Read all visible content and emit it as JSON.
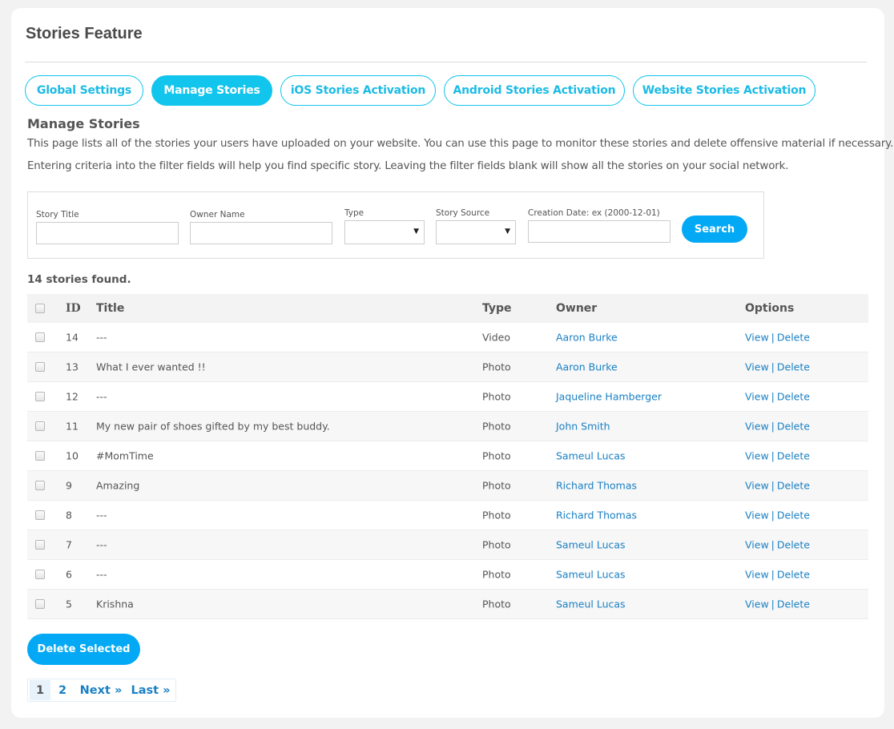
{
  "header": {
    "title": "Stories Feature"
  },
  "tabs": [
    {
      "label": "Global Settings",
      "active": false
    },
    {
      "label": "Manage Stories",
      "active": true
    },
    {
      "label": "iOS Stories Activation",
      "active": false
    },
    {
      "label": "Android Stories Activation",
      "active": false
    },
    {
      "label": "Website Stories Activation",
      "active": false
    }
  ],
  "section": {
    "title": "Manage Stories",
    "description_1": "This page lists all of the stories your users have uploaded on your website. You can use this page to monitor these stories and delete offensive material if necessary.",
    "description_2": "Entering criteria into the filter fields will help you find specific story. Leaving the filter fields blank will show all the stories on your social network."
  },
  "filters": {
    "story_title": {
      "label": "Story Title",
      "value": ""
    },
    "owner_name": {
      "label": "Owner Name",
      "value": ""
    },
    "type": {
      "label": "Type",
      "selected": ""
    },
    "story_source": {
      "label": "Story Source",
      "selected": ""
    },
    "creation_date": {
      "label": "Creation Date: ex (2000-12-01)",
      "value": ""
    },
    "search_label": "Search"
  },
  "results": {
    "count_text": "14 stories found."
  },
  "table": {
    "columns": {
      "id": "ID",
      "title": "Title",
      "type": "Type",
      "owner": "Owner",
      "options": "Options"
    },
    "view_label": "View",
    "delete_label": "Delete",
    "separator": "|",
    "rows": [
      {
        "id": "14",
        "title": "---",
        "type": "Video",
        "owner": "Aaron Burke"
      },
      {
        "id": "13",
        "title": "What I ever wanted !!",
        "type": "Photo",
        "owner": "Aaron Burke"
      },
      {
        "id": "12",
        "title": "---",
        "type": "Photo",
        "owner": "Jaqueline Hamberger"
      },
      {
        "id": "11",
        "title": "My new pair of shoes gifted by my best buddy.",
        "type": "Photo",
        "owner": "John Smith"
      },
      {
        "id": "10",
        "title": "#MomTime",
        "type": "Photo",
        "owner": "Sameul Lucas"
      },
      {
        "id": "9",
        "title": "Amazing",
        "type": "Photo",
        "owner": "Richard Thomas"
      },
      {
        "id": "8",
        "title": "---",
        "type": "Photo",
        "owner": "Richard Thomas"
      },
      {
        "id": "7",
        "title": "---",
        "type": "Photo",
        "owner": "Sameul Lucas"
      },
      {
        "id": "6",
        "title": "---",
        "type": "Photo",
        "owner": "Sameul Lucas"
      },
      {
        "id": "5",
        "title": "Krishna",
        "type": "Photo",
        "owner": "Sameul Lucas"
      }
    ]
  },
  "actions": {
    "delete_selected_label": "Delete Selected"
  },
  "pagination": {
    "current": "1",
    "pages": [
      "2"
    ],
    "next_label": "Next »",
    "last_label": "Last »"
  },
  "colors": {
    "accent": "#12c5ed",
    "button": "#03a9f4",
    "link": "#1a80c4",
    "background": "#f2f2f2"
  }
}
